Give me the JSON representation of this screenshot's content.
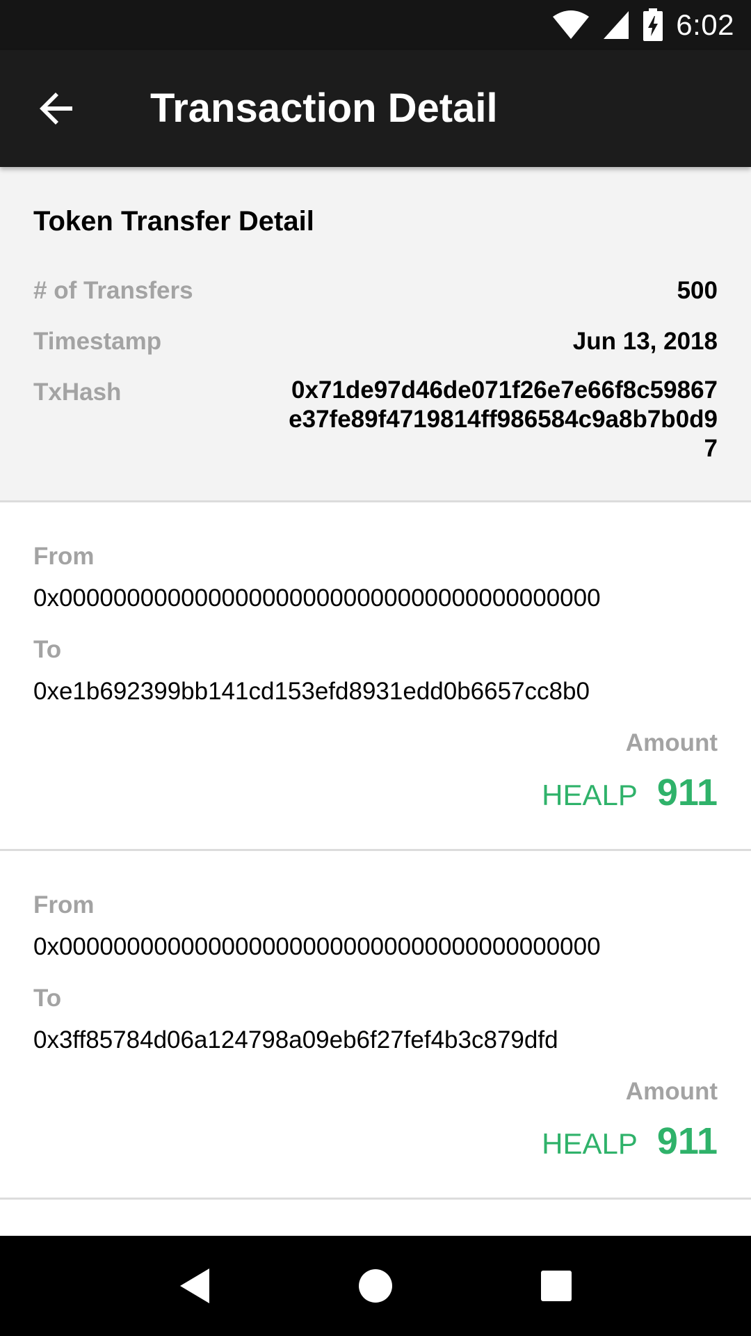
{
  "status_bar": {
    "time": "6:02",
    "icons": [
      "wifi-icon",
      "signal-icon",
      "battery-charging-icon"
    ]
  },
  "app_bar": {
    "back_icon": "arrow-back-icon",
    "title": "Transaction Detail"
  },
  "summary": {
    "heading": "Token Transfer Detail",
    "transfers_label": "# of Transfers",
    "transfers_value": "500",
    "timestamp_label": "Timestamp",
    "timestamp_value": "Jun 13, 2018",
    "txhash_label": "TxHash",
    "txhash_value": "0x71de97d46de071f26e7e66f8c59867e37fe89f4719814ff986584c9a8b7b0d97"
  },
  "transfers": [
    {
      "from_label": "From",
      "from": "0x0000000000000000000000000000000000000000",
      "to_label": "To",
      "to": "0xe1b692399bb141cd153efd8931edd0b6657cc8b0",
      "amount_label": "Amount",
      "token": "HEALP",
      "amount": "911"
    },
    {
      "from_label": "From",
      "from": "0x0000000000000000000000000000000000000000",
      "to_label": "To",
      "to": "0x3ff85784d06a124798a09eb6f27fef4b3c879dfd",
      "amount_label": "Amount",
      "token": "HEALP",
      "amount": "911"
    }
  ],
  "nav_bar": {
    "icons": [
      "nav-back-icon",
      "nav-home-icon",
      "nav-recents-icon"
    ]
  },
  "colors": {
    "amount_green": "#2fb26a",
    "label_gray": "#a3a3a3",
    "app_bar": "#1c1c1c",
    "summary_bg": "#f3f3f3"
  }
}
